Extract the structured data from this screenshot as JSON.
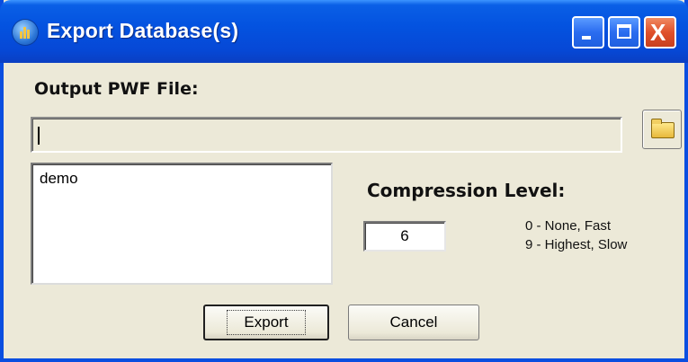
{
  "window": {
    "title": "Export Database(s)",
    "title_bar_color": "#0453e0",
    "background_color": "#ece9d8",
    "controls": {
      "minimize_icon": "minimize-icon",
      "maximize_icon": "maximize-icon",
      "close_icon": "close-icon",
      "close_glyph": "X"
    }
  },
  "output": {
    "label": "Output PWF File:",
    "path_value": "",
    "browse_icon": "folder-icon"
  },
  "databases": {
    "items": [
      "demo"
    ]
  },
  "compression": {
    "label": "Compression Level:",
    "value": "6",
    "hint_min": "0 - None, Fast",
    "hint_max": "9 - Highest, Slow"
  },
  "buttons": {
    "export_label": "Export",
    "cancel_label": "Cancel"
  }
}
